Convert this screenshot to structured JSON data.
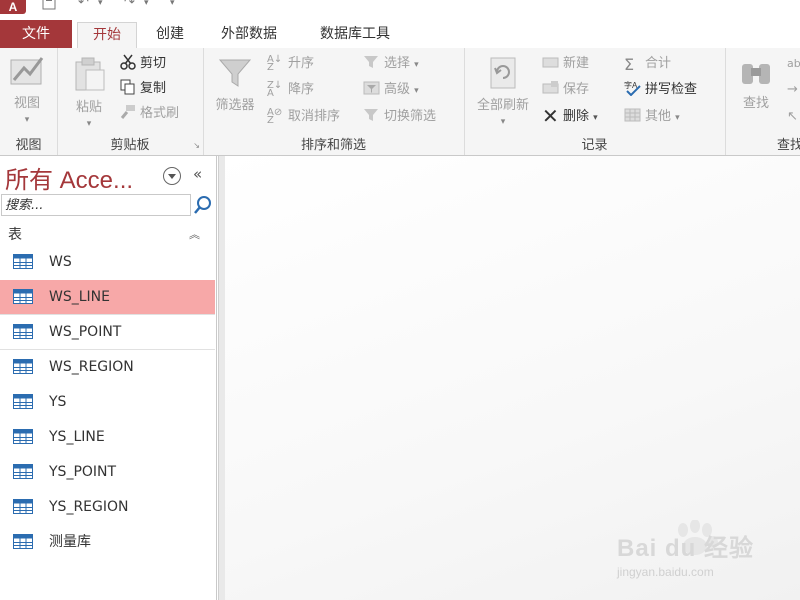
{
  "app": {
    "logo_text": "A"
  },
  "tabs": [
    "文件",
    "开始",
    "创建",
    "外部数据",
    "数据库工具"
  ],
  "ribbon": {
    "view": {
      "button": "视图",
      "group_label": "视图"
    },
    "clipboard": {
      "paste": "粘贴",
      "cut": "剪切",
      "copy": "复制",
      "format_painter": "格式刷",
      "group_label": "剪贴板"
    },
    "sort_filter": {
      "filter": "筛选器",
      "ascending": "升序",
      "descending": "降序",
      "clear_sort": "取消排序",
      "selection": "选择",
      "advanced": "高级",
      "toggle_filter": "切换筛选",
      "group_label": "排序和筛选"
    },
    "records": {
      "refresh_all": "全部刷新",
      "new": "新建",
      "save": "保存",
      "delete": "删除",
      "totals": "合计",
      "spelling": "拼写检查",
      "more": "其他",
      "group_label": "记录"
    },
    "find": {
      "button": "查找",
      "group_label": "查找"
    }
  },
  "nav": {
    "title": "所有 Acce...",
    "search_placeholder": "搜索...",
    "group_header": "表",
    "items": [
      "WS",
      "WS_LINE",
      "WS_POINT",
      "WS_REGION",
      "YS",
      "YS_LINE",
      "YS_POINT",
      "YS_REGION",
      "测量库"
    ],
    "selected_index": 1
  },
  "watermark": {
    "text": "Bai du 经验",
    "sub": "jingyan.baidu.com"
  },
  "colors": {
    "accent": "#a4373a",
    "selected": "#f7a8a8"
  }
}
